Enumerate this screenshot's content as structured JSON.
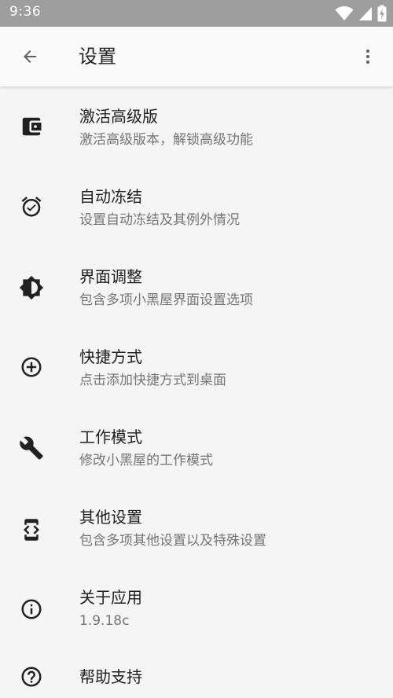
{
  "status_bar": {
    "time": "9:36",
    "icons": [
      "wifi-icon",
      "signal-icon",
      "battery-charging-icon"
    ],
    "color": "#9e9e9e"
  },
  "app_bar": {
    "title": "设置",
    "back_icon": "arrow-back-icon",
    "menu_icon": "more-vert-icon"
  },
  "settings": [
    {
      "icon": "wallet-icon",
      "title": "激活高级版",
      "subtitle": "激活高级版本，解锁高级功能"
    },
    {
      "icon": "alarm-icon",
      "title": "自动冻结",
      "subtitle": "设置自动冻结及其例外情况"
    },
    {
      "icon": "brightness-icon",
      "title": "界面调整",
      "subtitle": "包含多项小黑屋界面设置选项"
    },
    {
      "icon": "add-circle-icon",
      "title": "快捷方式",
      "subtitle": "点击添加快捷方式到桌面"
    },
    {
      "icon": "wrench-icon",
      "title": "工作模式",
      "subtitle": "修改小黑屋的工作模式"
    },
    {
      "icon": "developer-mode-icon",
      "title": "其他设置",
      "subtitle": "包含多项其他设置以及特殊设置"
    },
    {
      "icon": "info-icon",
      "title": "关于应用",
      "subtitle": "1.9.18c"
    },
    {
      "icon": "help-icon",
      "title": "帮助支持",
      "subtitle": ""
    }
  ]
}
